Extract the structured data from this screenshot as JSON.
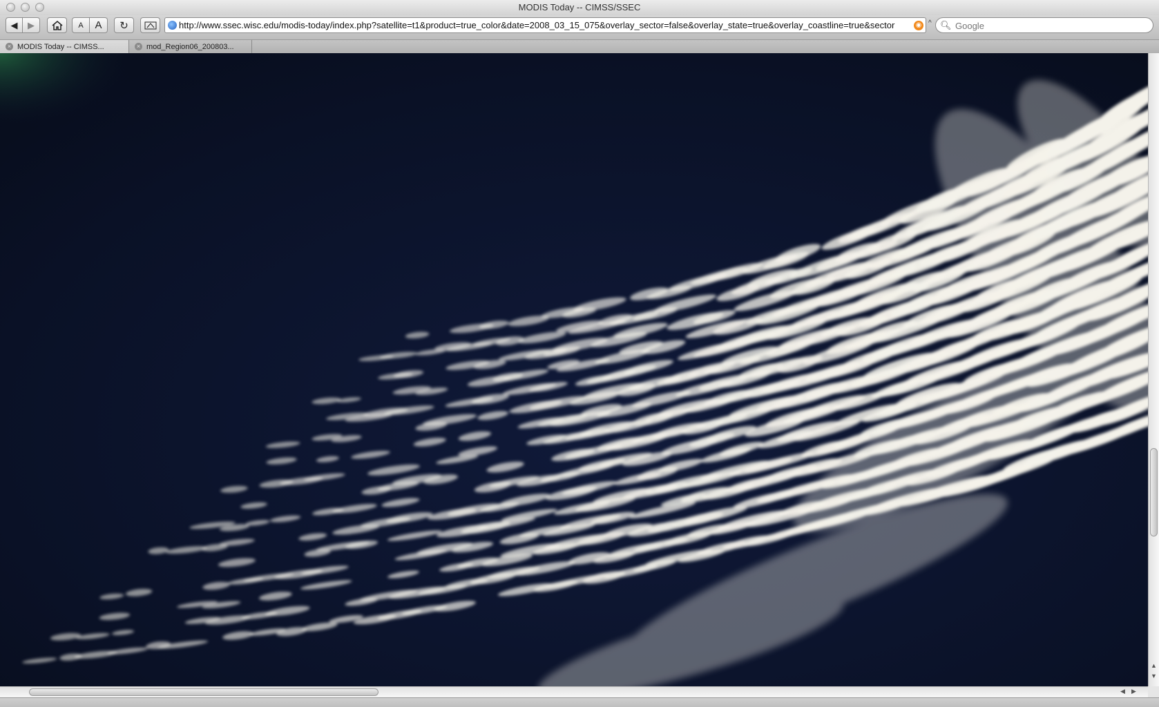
{
  "window": {
    "title": "MODIS Today -- CIMSS/SSEC"
  },
  "toolbar": {
    "back_icon": "back-arrow-icon",
    "forward_icon": "forward-arrow-icon",
    "home_icon": "home-icon",
    "text_smaller_label": "A",
    "text_larger_label": "A",
    "reload_icon": "reload-icon",
    "snapback_icon": "snapback-icon",
    "url": "http://www.ssec.wisc.edu/modis-today/index.php?satellite=t1&product=true_color&date=2008_03_15_075&overlay_sector=false&overlay_state=true&overlay_coastline=true&sector",
    "search_placeholder": "Google"
  },
  "tabs": [
    {
      "label": "MODIS Today -- CIMSS...",
      "active": true
    },
    {
      "label": "mod_Region06_200803...",
      "active": false
    }
  ],
  "content": {
    "image_subject": "satellite-true-color-cloud-streets",
    "ocean_color": "#0b1228",
    "cloud_color": "#f4f2ea"
  },
  "colors": {
    "chrome_light": "#ececec",
    "chrome_dark": "#bdbdbd",
    "rss_accent": "#f28a1c",
    "globe_accent": "#1f5fbf"
  }
}
